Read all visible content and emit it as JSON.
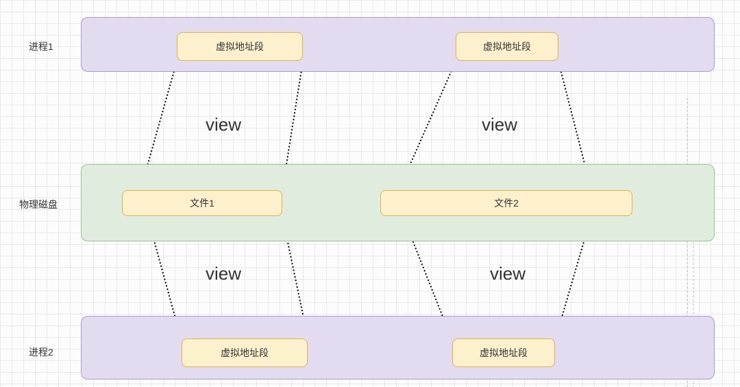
{
  "labels": {
    "process1": "进程1",
    "process2": "进程2",
    "disk": "物理磁盘"
  },
  "boxes": {
    "vaddr_p1_left": "虚拟地址段",
    "vaddr_p1_right": "虚拟地址段",
    "vaddr_p2_left": "虚拟地址段",
    "vaddr_p2_right": "虚拟地址段",
    "file1": "文件1",
    "file2": "文件2"
  },
  "view": {
    "top_left": "view",
    "top_right": "view",
    "bottom_left": "view",
    "bottom_right": "view"
  }
}
